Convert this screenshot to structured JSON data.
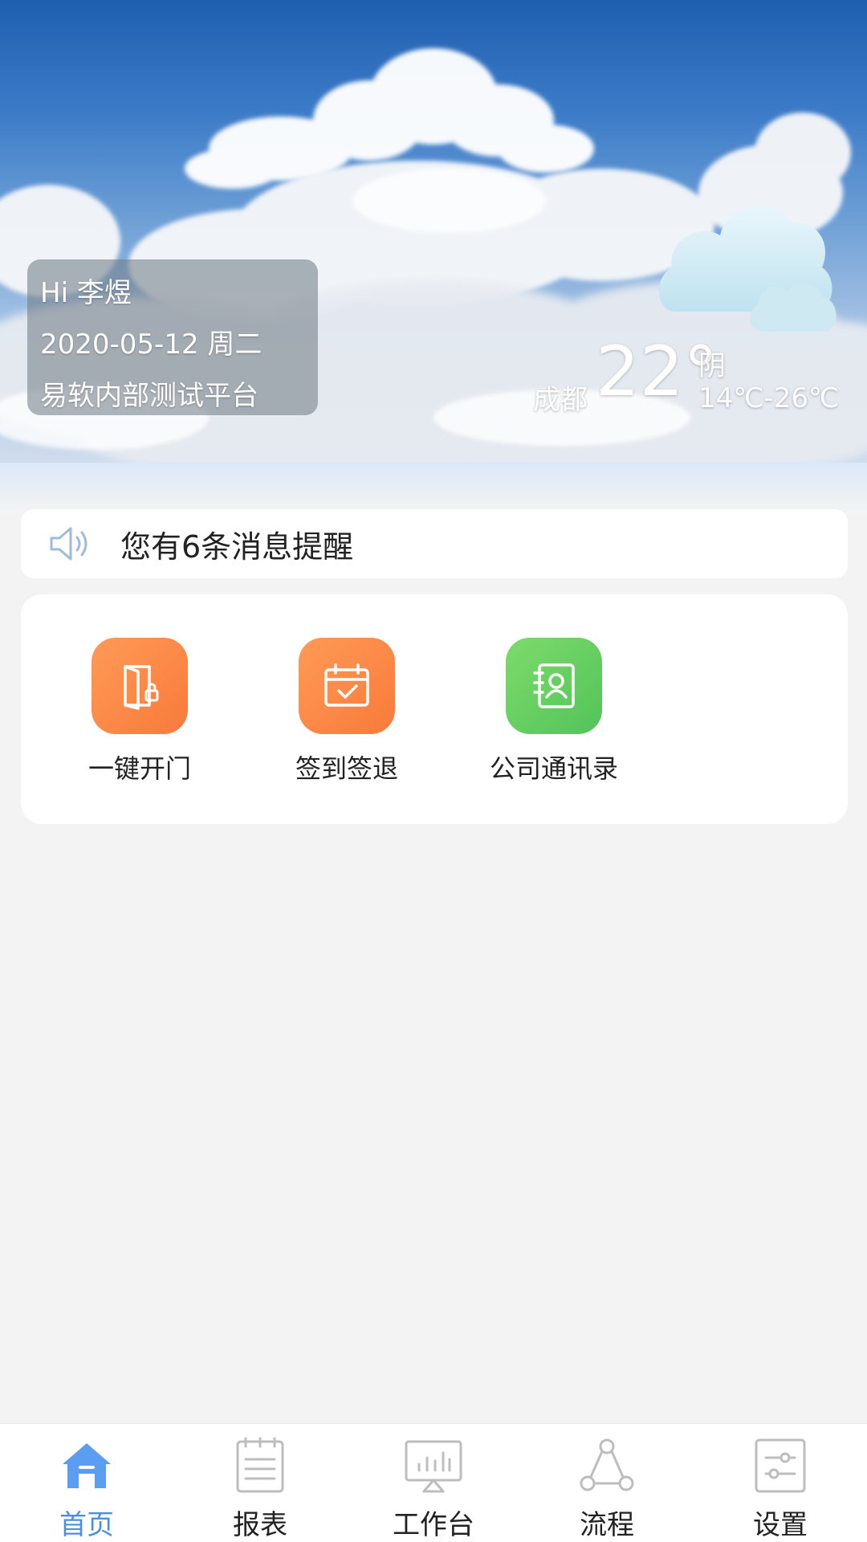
{
  "weather": {
    "city": "成都",
    "temperature": "22°",
    "condition": "阴",
    "range": "14℃-26℃",
    "icon": "cloudy-icon"
  },
  "greeting": {
    "hello": "Hi 李煜",
    "date": "2020-05-12 周二",
    "platform": "易软内部测试平台"
  },
  "notice": {
    "icon": "speaker-icon",
    "text": "您有6条消息提醒"
  },
  "apps": [
    {
      "label": "一键开门",
      "icon": "door-icon",
      "color": "#f97a3a"
    },
    {
      "label": "签到签退",
      "icon": "calendar-check-icon",
      "color": "#f97a3a"
    },
    {
      "label": "公司通讯录",
      "icon": "contacts-icon",
      "color": "#52c35a"
    }
  ],
  "nav": {
    "active_color": "#4a90e2",
    "items": [
      {
        "label": "首页",
        "icon": "home-icon",
        "active": true
      },
      {
        "label": "报表",
        "icon": "report-icon",
        "active": false
      },
      {
        "label": "工作台",
        "icon": "workbench-icon",
        "active": false
      },
      {
        "label": "流程",
        "icon": "process-icon",
        "active": false
      },
      {
        "label": "设置",
        "icon": "settings-icon",
        "active": false
      }
    ]
  }
}
